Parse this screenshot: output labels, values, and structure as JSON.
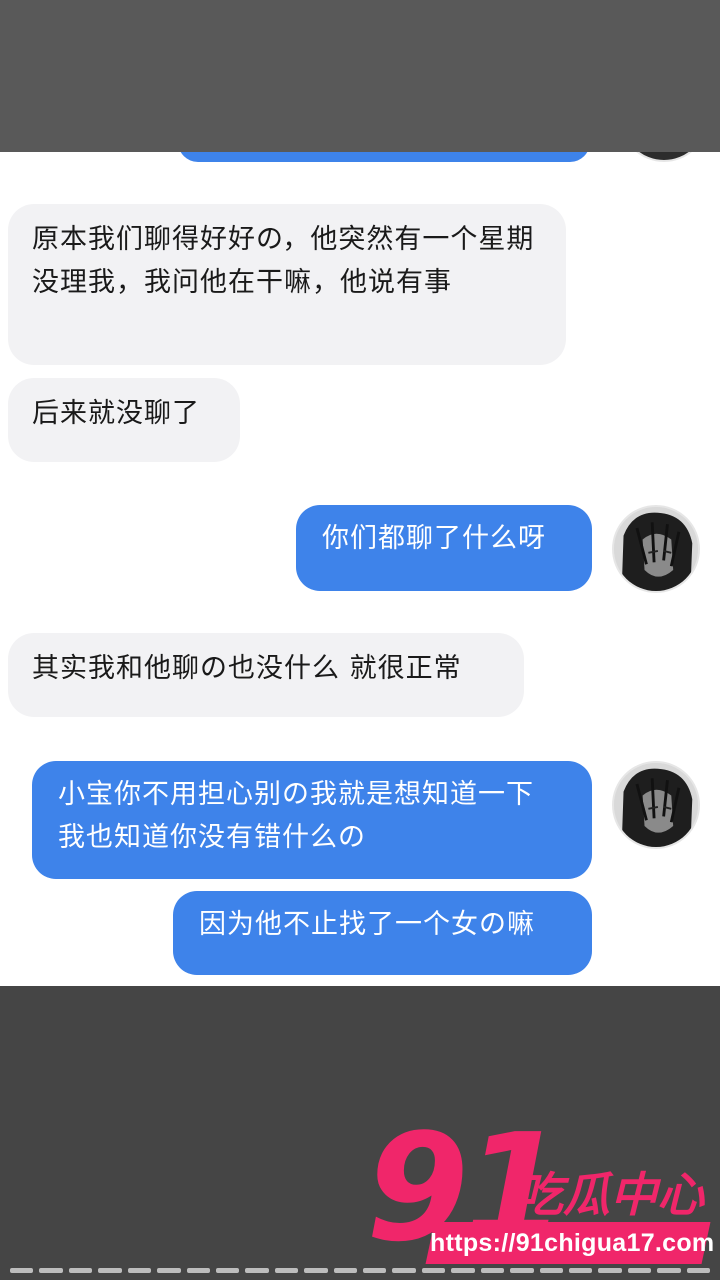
{
  "chat": {
    "messages": [
      {
        "side": "incoming",
        "text": "原本我们聊得好好の，他突然有一个星期没理我，我问他在干嘛，他说有事"
      },
      {
        "side": "incoming",
        "text": "后来就没聊了"
      },
      {
        "side": "outgoing",
        "text": "你们都聊了什么呀"
      },
      {
        "side": "incoming",
        "text": "其实我和他聊の也没什么 就很正常"
      },
      {
        "side": "outgoing",
        "text": "小宝你不用担心别の我就是想知道一下 我也知道你没有错什么の"
      },
      {
        "side": "outgoing",
        "text": "因为他不止找了一个女の嘛"
      }
    ]
  },
  "watermark": {
    "number": "91",
    "name": "吃瓜中心",
    "url": "https://91chigua17.com"
  },
  "colors": {
    "incoming_bubble": "#f2f2f4",
    "outgoing_bubble": "#3e83ea",
    "watermark": "#f0266a"
  }
}
